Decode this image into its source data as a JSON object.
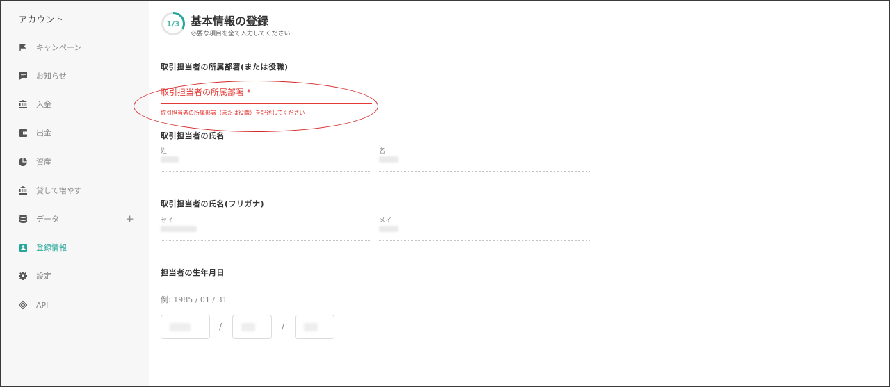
{
  "sidebar": {
    "title": "アカウント",
    "items": [
      {
        "label": "キャンペーン",
        "icon": "flag-icon"
      },
      {
        "label": "お知らせ",
        "icon": "message-icon"
      },
      {
        "label": "入金",
        "icon": "bank-icon"
      },
      {
        "label": "出金",
        "icon": "wallet-icon"
      },
      {
        "label": "資産",
        "icon": "pie-chart-icon"
      },
      {
        "label": "貸して増やす",
        "icon": "bank-icon"
      },
      {
        "label": "データ",
        "icon": "database-icon",
        "expand": "+"
      },
      {
        "label": "登録情報",
        "icon": "id-card-icon",
        "active": true
      },
      {
        "label": "設定",
        "icon": "gear-icon"
      },
      {
        "label": "API",
        "icon": "api-icon"
      }
    ]
  },
  "header": {
    "progress": "1/3",
    "progress_fraction": 0.333,
    "title": "基本情報の登録",
    "subtitle": "必要な項目を全て入力してください"
  },
  "department": {
    "section_label": "取引担当者の所属部署(または役職)",
    "field_label": "取引担当者の所属部署 *",
    "error_text": "取引担当者の所属部署（または役職）を記述してください"
  },
  "name": {
    "section_label": "取引担当者の氏名",
    "last_label": "姓",
    "first_label": "名"
  },
  "kana": {
    "section_label": "取引担当者の氏名(フリガナ)",
    "last_label": "セイ",
    "first_label": "メイ"
  },
  "birthday": {
    "section_label": "担当者の生年月日",
    "example": "例: 1985 / 01 / 31",
    "separator": "/"
  },
  "colors": {
    "accent": "#26a69a",
    "error": "#e53935",
    "annotation": "#d62828"
  }
}
